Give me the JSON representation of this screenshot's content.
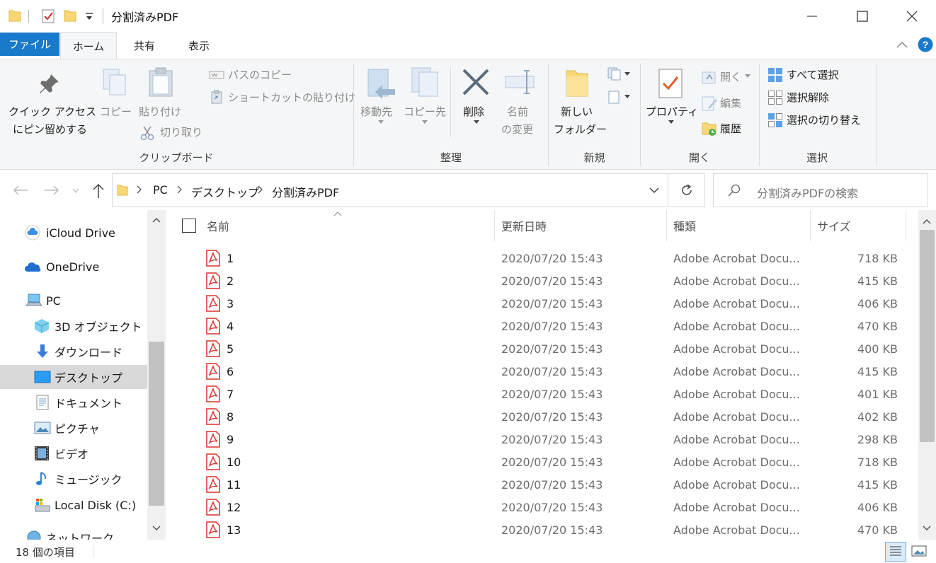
{
  "window": {
    "title": "分割済みPDF",
    "controls": [
      "minimize",
      "maximize",
      "close"
    ]
  },
  "ribbon_tabs": [
    {
      "label": "ファイル",
      "active": false
    },
    {
      "label": "ホーム",
      "active": true
    },
    {
      "label": "共有",
      "active": false
    },
    {
      "label": "表示",
      "active": false
    }
  ],
  "ribbon": {
    "clipboard": {
      "pin_label_1": "クイック アクセス",
      "pin_label_2": "にピン留めする",
      "copy": "コピー",
      "paste": "貼り付け",
      "cut": "切り取り",
      "copy_path": "パスのコピー",
      "paste_shortcut": "ショートカットの貼り付け",
      "group": "クリップボード"
    },
    "organize": {
      "move_to": "移動先",
      "copy_to": "コピー先",
      "delete": "削除",
      "rename_1": "名前",
      "rename_2": "の変更",
      "group": "整理"
    },
    "new": {
      "new_folder_1": "新しい",
      "new_folder_2": "フォルダー",
      "group": "新規"
    },
    "open": {
      "properties": "プロパティ",
      "open": "開く",
      "edit": "編集",
      "history": "履歴",
      "group": "開く"
    },
    "select": {
      "select_all": "すべて選択",
      "select_none": "選択解除",
      "invert": "選択の切り替え",
      "group": "選択"
    }
  },
  "address": {
    "crumbs": [
      "PC",
      "デスクトップ",
      "分割済みPDF"
    ],
    "search_placeholder": "分割済みPDFの検索"
  },
  "nav": {
    "items": [
      {
        "label": "iCloud Drive",
        "icon": "cloud-icon"
      },
      {
        "label": "OneDrive",
        "icon": "onedrive-icon"
      },
      {
        "label": "PC",
        "icon": "computer-icon"
      },
      {
        "label": "3D オブジェクト",
        "icon": "cube-icon"
      },
      {
        "label": "ダウンロード",
        "icon": "download-icon"
      },
      {
        "label": "デスクトップ",
        "icon": "desktop-icon",
        "selected": true
      },
      {
        "label": "ドキュメント",
        "icon": "document-icon"
      },
      {
        "label": "ピクチャ",
        "icon": "picture-icon"
      },
      {
        "label": "ビデオ",
        "icon": "video-icon"
      },
      {
        "label": "ミュージック",
        "icon": "music-icon"
      },
      {
        "label": "Local Disk (C:)",
        "icon": "disk-icon"
      },
      {
        "label": "ネットワーク",
        "icon": "network-icon"
      }
    ]
  },
  "columns": {
    "name": "名前",
    "date": "更新日時",
    "type": "種類",
    "size": "サイズ"
  },
  "files": [
    {
      "name": "1",
      "date": "2020/07/20 15:43",
      "type": "Adobe Acrobat Docu...",
      "size": "718 KB"
    },
    {
      "name": "2",
      "date": "2020/07/20 15:43",
      "type": "Adobe Acrobat Docu...",
      "size": "415 KB"
    },
    {
      "name": "3",
      "date": "2020/07/20 15:43",
      "type": "Adobe Acrobat Docu...",
      "size": "406 KB"
    },
    {
      "name": "4",
      "date": "2020/07/20 15:43",
      "type": "Adobe Acrobat Docu...",
      "size": "470 KB"
    },
    {
      "name": "5",
      "date": "2020/07/20 15:43",
      "type": "Adobe Acrobat Docu...",
      "size": "400 KB"
    },
    {
      "name": "6",
      "date": "2020/07/20 15:43",
      "type": "Adobe Acrobat Docu...",
      "size": "415 KB"
    },
    {
      "name": "7",
      "date": "2020/07/20 15:43",
      "type": "Adobe Acrobat Docu...",
      "size": "401 KB"
    },
    {
      "name": "8",
      "date": "2020/07/20 15:43",
      "type": "Adobe Acrobat Docu...",
      "size": "402 KB"
    },
    {
      "name": "9",
      "date": "2020/07/20 15:43",
      "type": "Adobe Acrobat Docu...",
      "size": "298 KB"
    },
    {
      "name": "10",
      "date": "2020/07/20 15:43",
      "type": "Adobe Acrobat Docu...",
      "size": "718 KB"
    },
    {
      "name": "11",
      "date": "2020/07/20 15:43",
      "type": "Adobe Acrobat Docu...",
      "size": "415 KB"
    },
    {
      "name": "12",
      "date": "2020/07/20 15:43",
      "type": "Adobe Acrobat Docu...",
      "size": "406 KB"
    },
    {
      "name": "13",
      "date": "2020/07/20 15:43",
      "type": "Adobe Acrobat Docu...",
      "size": "470 KB"
    }
  ],
  "status": {
    "item_count": "18 個の項目"
  },
  "colors": {
    "file_tab": "#1979ca",
    "pdf_red": "#d9302c",
    "folder_yellow": "#f8d775",
    "selection": "#d9d9d9",
    "help_blue": "#1979ca"
  }
}
